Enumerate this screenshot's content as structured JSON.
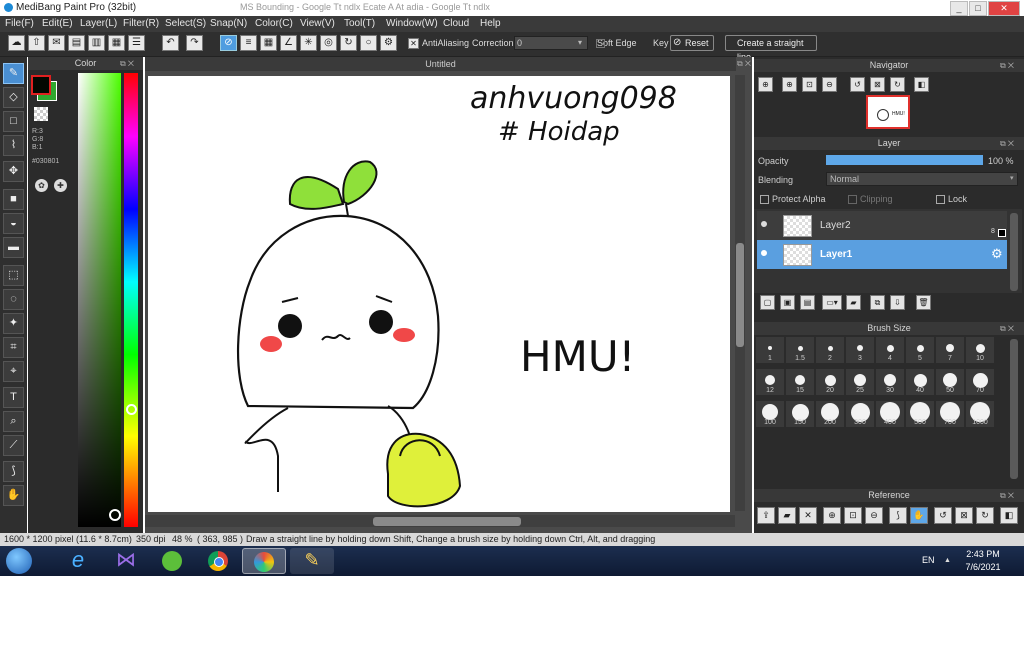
{
  "window": {
    "title": "MediBang Paint Pro (32bit)",
    "background_tabs_text": "MS Bounding - Google Tt ndlx Ecate   A   At adia - Google Tt ndlx",
    "minimize": "_",
    "maximize": "□",
    "close": "✕"
  },
  "menu": [
    "File(F)",
    "Edit(E)",
    "Layer(L)",
    "Filter(R)",
    "Select(S)",
    "Snap(N)",
    "Color(C)",
    "View(V)",
    "Tool(T)",
    "Window(W)",
    "Cloud",
    "Help"
  ],
  "toolbar": {
    "antialiasing_label": "AntiAliasing",
    "correction_label": "Correction",
    "correction_value": "0",
    "soft_edge_label": "Soft Edge",
    "key_label": "Key",
    "reset_label": "Reset",
    "straight_line_label": "Create a straight line"
  },
  "color_panel": {
    "title": "Color",
    "r": "R:3",
    "g": "G:8",
    "b": "B:1",
    "hex": "#030801",
    "foreground": "#030801",
    "background": "#2fa82f"
  },
  "canvas": {
    "tab_title": "Untitled",
    "handwriting_line1": "anhvuong098",
    "handwriting_line2": "# Hoidap",
    "hmu_text": "HMU!"
  },
  "navigator": {
    "title": "Navigator",
    "thumb_text": "HMU!"
  },
  "layer_panel": {
    "title": "Layer",
    "opacity_label": "Opacity",
    "opacity_value": "100 %",
    "opacity_fraction": 1.0,
    "blending_label": "Blending",
    "blending_value": "Normal",
    "protect_alpha": "Protect Alpha",
    "clipping": "Clipping",
    "lock": "Lock",
    "layers": [
      {
        "name": "Layer2",
        "badge": "8"
      },
      {
        "name": "Layer1",
        "badge": ""
      }
    ]
  },
  "brush_size": {
    "title": "Brush Size",
    "sizes": [
      "1",
      "1.5",
      "2",
      "3",
      "4",
      "5",
      "7",
      "10",
      "12",
      "15",
      "20",
      "25",
      "30",
      "40",
      "50",
      "70",
      "100",
      "150",
      "200",
      "300",
      "400",
      "500",
      "700",
      "1000"
    ]
  },
  "reference": {
    "title": "Reference"
  },
  "status": {
    "dimensions": "1600 * 1200 pixel",
    "physical": "(11.6 * 8.7cm)",
    "dpi": "350 dpi",
    "zoom": "48 %",
    "coords": "( 363, 985 )",
    "hint": "Draw a straight line by holding down Shift, Change a brush size by holding down Ctrl, Alt, and dragging"
  },
  "taskbar": {
    "lang": "EN",
    "time": "2:43 PM",
    "date": "7/6/2021"
  },
  "icons": {
    "colors": {
      "accent": "#4f9de0",
      "sprout_green": "#8fe03a",
      "bag_yellow": "#dff03a",
      "blush": "#f04848"
    }
  }
}
